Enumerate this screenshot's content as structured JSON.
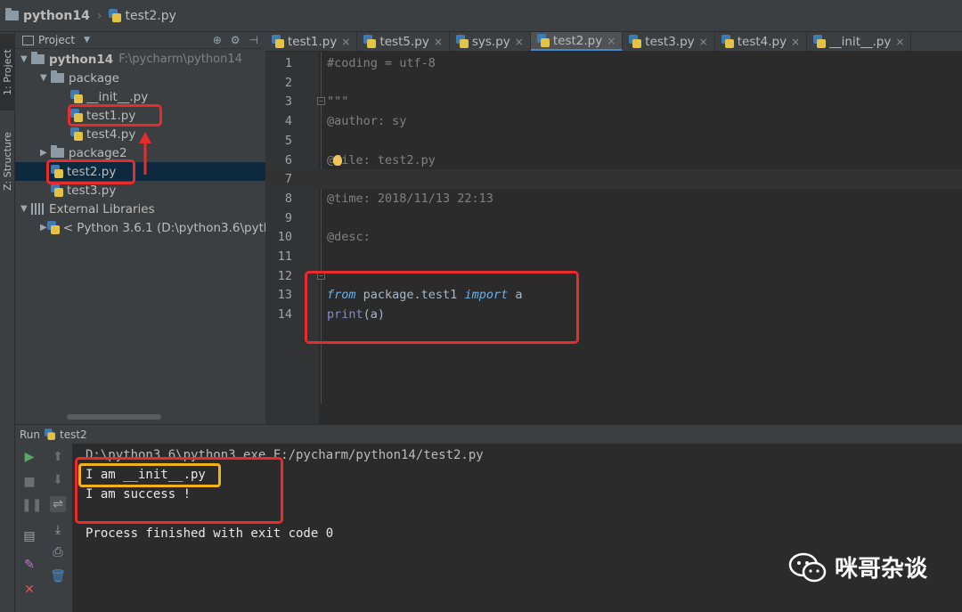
{
  "breadcrumb": {
    "project": "python14",
    "file": "test2.py"
  },
  "tool_windows": {
    "project_tab": "1: Project",
    "structure_tab": "Z: Structure"
  },
  "project_panel": {
    "header_label": "Project",
    "tree": [
      {
        "label": "python14",
        "hint": "F:\\pycharm\\python14",
        "type": "folder",
        "expanded": true,
        "depth": 0
      },
      {
        "label": "package",
        "type": "folder",
        "expanded": true,
        "depth": 1
      },
      {
        "label": "__init__.py",
        "type": "py",
        "depth": 2
      },
      {
        "label": "test1.py",
        "type": "py",
        "depth": 2
      },
      {
        "label": "test4.py",
        "type": "py",
        "depth": 2
      },
      {
        "label": "package2",
        "type": "folder",
        "expanded": false,
        "depth": 1
      },
      {
        "label": "test2.py",
        "type": "py",
        "depth": 1,
        "selected": true
      },
      {
        "label": "test3.py",
        "type": "py",
        "depth": 1
      },
      {
        "label": "External Libraries",
        "type": "library",
        "expanded": true,
        "depth": 0
      },
      {
        "label": "< Python 3.6.1 (D:\\python3.6\\pyth",
        "type": "py",
        "expanded": false,
        "depth": 1
      }
    ]
  },
  "editor_tabs": [
    {
      "label": "test1.py",
      "active": false
    },
    {
      "label": "test5.py",
      "active": false
    },
    {
      "label": "sys.py",
      "active": false
    },
    {
      "label": "test2.py",
      "active": true
    },
    {
      "label": "test3.py",
      "active": false
    },
    {
      "label": "test4.py",
      "active": false
    },
    {
      "label": "__init__.py",
      "active": false
    }
  ],
  "editor": {
    "current_line": 7,
    "lines": [
      {
        "n": "1",
        "parts": [
          {
            "t": "#coding = utf-8",
            "c": "cm"
          }
        ]
      },
      {
        "n": "2",
        "parts": []
      },
      {
        "n": "3",
        "parts": [
          {
            "t": "\"\"\"",
            "c": "cm"
          }
        ]
      },
      {
        "n": "4",
        "parts": [
          {
            "t": "@author: sy",
            "c": "cm"
          }
        ]
      },
      {
        "n": "5",
        "parts": []
      },
      {
        "n": "6",
        "parts": [
          {
            "t": "@file: test2.py",
            "c": "cm"
          }
        ]
      },
      {
        "n": "7",
        "parts": []
      },
      {
        "n": "8",
        "parts": [
          {
            "t": "@time: 2018/11/13 22:13",
            "c": "cm"
          }
        ]
      },
      {
        "n": "9",
        "parts": []
      },
      {
        "n": "10",
        "parts": [
          {
            "t": "@desc:",
            "c": "cm"
          }
        ]
      },
      {
        "n": "11",
        "parts": []
      },
      {
        "n": "12",
        "parts": []
      },
      {
        "n": "13",
        "parts": [
          {
            "t": "from",
            "c": "kw"
          },
          {
            "t": " package.test1 ",
            "c": "id"
          },
          {
            "t": "import",
            "c": "kw"
          },
          {
            "t": " a",
            "c": "id"
          }
        ]
      },
      {
        "n": "14",
        "parts": [
          {
            "t": "print",
            "c": "fn"
          },
          {
            "t": "(a)",
            "c": "id"
          }
        ]
      }
    ]
  },
  "run_panel": {
    "header_label": "Run",
    "config_name": "test2",
    "console": {
      "command": "D:\\python3.6\\python3.exe F:/pycharm/python14/test2.py",
      "output_1": "I am __init__.py",
      "output_2": "I am success !",
      "exit": "Process finished with exit code 0"
    }
  },
  "watermark": {
    "text": "咪哥杂谈"
  },
  "colors": {
    "annotation_red": "#e82c2c",
    "annotation_yellow": "#f2b21a",
    "selection": "#0d293e",
    "accent": "#4a88c7"
  }
}
